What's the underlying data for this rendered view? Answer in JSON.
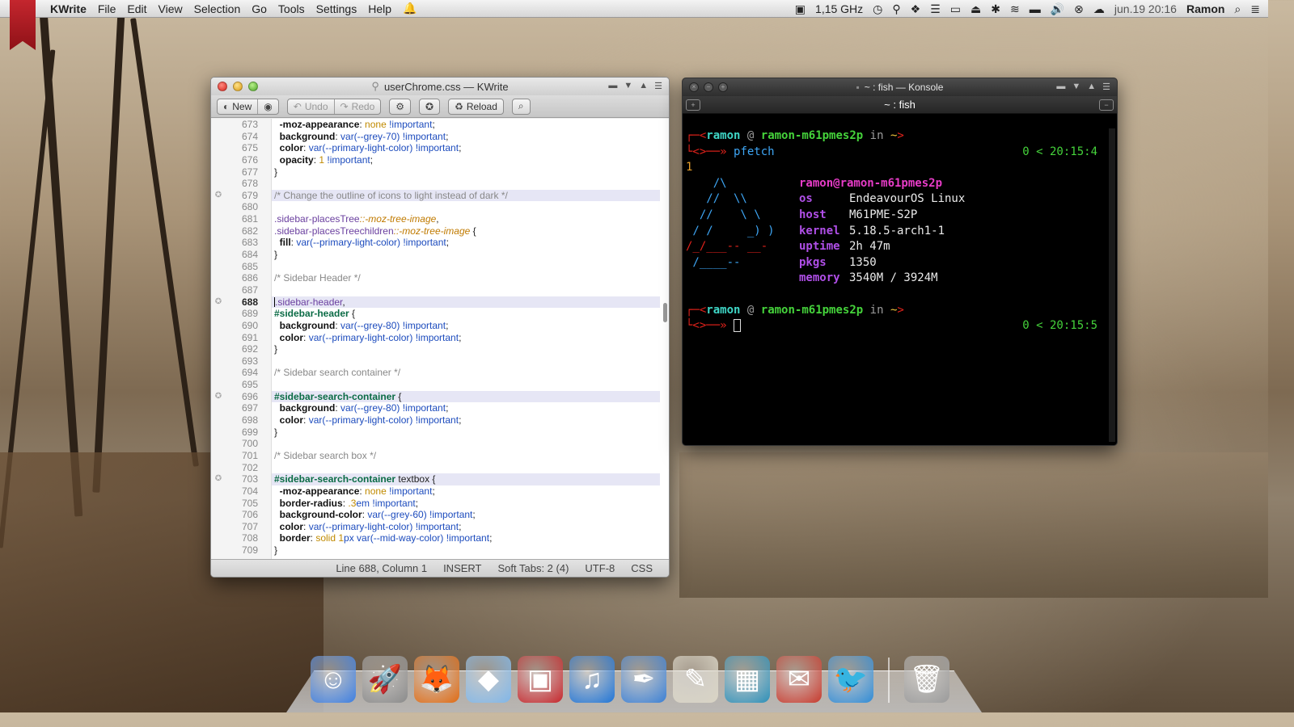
{
  "menubar": {
    "app_name": "KWrite",
    "menus": [
      "File",
      "Edit",
      "View",
      "Selection",
      "Go",
      "Tools",
      "Settings",
      "Help"
    ],
    "cpu_freq": "1,15 GHz",
    "datetime": "jun.19 20:16",
    "user": "Ramon"
  },
  "kwrite": {
    "title": "userChrome.css — KWrite",
    "toolbar": {
      "new": "New",
      "undo": "Undo",
      "redo": "Redo",
      "reload": "Reload"
    },
    "lines": [
      {
        "num": "673",
        "mark": false,
        "hl": false,
        "parts": [
          [
            "prop",
            "  -moz-appearance"
          ],
          [
            "plain",
            ": "
          ],
          [
            "kw",
            "none"
          ],
          [
            "imp",
            " !important"
          ],
          [
            "plain",
            ";"
          ]
        ]
      },
      {
        "num": "674",
        "mark": false,
        "hl": false,
        "parts": [
          [
            "prop",
            "  background"
          ],
          [
            "plain",
            ": "
          ],
          [
            "val",
            "var(--grey-70)"
          ],
          [
            "imp",
            " !important"
          ],
          [
            "plain",
            ";"
          ]
        ]
      },
      {
        "num": "675",
        "mark": false,
        "hl": false,
        "parts": [
          [
            "prop",
            "  color"
          ],
          [
            "plain",
            ": "
          ],
          [
            "val",
            "var(--primary-light-color)"
          ],
          [
            "imp",
            " !important"
          ],
          [
            "plain",
            ";"
          ]
        ]
      },
      {
        "num": "676",
        "mark": false,
        "hl": false,
        "parts": [
          [
            "prop",
            "  opacity"
          ],
          [
            "plain",
            ": "
          ],
          [
            "kw",
            "1"
          ],
          [
            "imp",
            " !important"
          ],
          [
            "plain",
            ";"
          ]
        ]
      },
      {
        "num": "677",
        "mark": false,
        "hl": false,
        "parts": [
          [
            "plain",
            "}"
          ]
        ]
      },
      {
        "num": "678",
        "mark": false,
        "hl": false,
        "parts": []
      },
      {
        "num": "679",
        "mark": true,
        "hl": true,
        "parts": [
          [
            "cmt",
            "/* Change the outline of icons to light instead of dark */"
          ]
        ]
      },
      {
        "num": "680",
        "mark": false,
        "hl": false,
        "parts": []
      },
      {
        "num": "681",
        "mark": false,
        "hl": false,
        "parts": [
          [
            "sel",
            ".sidebar-placesTree"
          ],
          [
            "pseudo",
            "::-moz-tree-image"
          ],
          [
            "plain",
            ","
          ]
        ]
      },
      {
        "num": "682",
        "mark": false,
        "hl": false,
        "parts": [
          [
            "sel",
            ".sidebar-placesTreechildren"
          ],
          [
            "pseudo",
            "::-moz-tree-image"
          ],
          [
            "plain",
            " {"
          ]
        ]
      },
      {
        "num": "683",
        "mark": false,
        "hl": false,
        "parts": [
          [
            "prop",
            "  fill"
          ],
          [
            "plain",
            ": "
          ],
          [
            "val",
            "var(--primary-light-color)"
          ],
          [
            "imp",
            " !important"
          ],
          [
            "plain",
            ";"
          ]
        ]
      },
      {
        "num": "684",
        "mark": false,
        "hl": false,
        "parts": [
          [
            "plain",
            "}"
          ]
        ]
      },
      {
        "num": "685",
        "mark": false,
        "hl": false,
        "parts": []
      },
      {
        "num": "686",
        "mark": false,
        "hl": false,
        "parts": [
          [
            "cmt",
            "/* Sidebar Header */"
          ]
        ]
      },
      {
        "num": "687",
        "mark": false,
        "hl": false,
        "parts": []
      },
      {
        "num": "688",
        "mark": true,
        "hl": true,
        "current": true,
        "parts": [
          [
            "sel",
            ".sidebar-header"
          ],
          [
            "plain",
            ","
          ]
        ]
      },
      {
        "num": "689",
        "mark": false,
        "hl": false,
        "parts": [
          [
            "idsel",
            "#sidebar-header"
          ],
          [
            "plain",
            " {"
          ]
        ]
      },
      {
        "num": "690",
        "mark": false,
        "hl": false,
        "parts": [
          [
            "prop",
            "  background"
          ],
          [
            "plain",
            ": "
          ],
          [
            "val",
            "var(--grey-80)"
          ],
          [
            "imp",
            " !important"
          ],
          [
            "plain",
            ";"
          ]
        ]
      },
      {
        "num": "691",
        "mark": false,
        "hl": false,
        "parts": [
          [
            "prop",
            "  color"
          ],
          [
            "plain",
            ": "
          ],
          [
            "val",
            "var(--primary-light-color)"
          ],
          [
            "imp",
            " !important"
          ],
          [
            "plain",
            ";"
          ]
        ]
      },
      {
        "num": "692",
        "mark": false,
        "hl": false,
        "parts": [
          [
            "plain",
            "}"
          ]
        ]
      },
      {
        "num": "693",
        "mark": false,
        "hl": false,
        "parts": []
      },
      {
        "num": "694",
        "mark": false,
        "hl": false,
        "parts": [
          [
            "cmt",
            "/* Sidebar search container */"
          ]
        ]
      },
      {
        "num": "695",
        "mark": false,
        "hl": false,
        "parts": []
      },
      {
        "num": "696",
        "mark": true,
        "hl": true,
        "parts": [
          [
            "idsel",
            "#sidebar-search-container"
          ],
          [
            "plain",
            " {"
          ]
        ]
      },
      {
        "num": "697",
        "mark": false,
        "hl": false,
        "parts": [
          [
            "prop",
            "  background"
          ],
          [
            "plain",
            ": "
          ],
          [
            "val",
            "var(--grey-80)"
          ],
          [
            "imp",
            " !important"
          ],
          [
            "plain",
            ";"
          ]
        ]
      },
      {
        "num": "698",
        "mark": false,
        "hl": false,
        "parts": [
          [
            "prop",
            "  color"
          ],
          [
            "plain",
            ": "
          ],
          [
            "val",
            "var(--primary-light-color)"
          ],
          [
            "imp",
            " !important"
          ],
          [
            "plain",
            ";"
          ]
        ]
      },
      {
        "num": "699",
        "mark": false,
        "hl": false,
        "parts": [
          [
            "plain",
            "}"
          ]
        ]
      },
      {
        "num": "700",
        "mark": false,
        "hl": false,
        "parts": []
      },
      {
        "num": "701",
        "mark": false,
        "hl": false,
        "parts": [
          [
            "cmt",
            "/* Sidebar search box */"
          ]
        ]
      },
      {
        "num": "702",
        "mark": false,
        "hl": false,
        "parts": []
      },
      {
        "num": "703",
        "mark": true,
        "hl": true,
        "parts": [
          [
            "idsel",
            "#sidebar-search-container"
          ],
          [
            "plain",
            " textbox {"
          ]
        ]
      },
      {
        "num": "704",
        "mark": false,
        "hl": false,
        "parts": [
          [
            "prop",
            "  -moz-appearance"
          ],
          [
            "plain",
            ": "
          ],
          [
            "kw",
            "none"
          ],
          [
            "imp",
            " !important"
          ],
          [
            "plain",
            ";"
          ]
        ]
      },
      {
        "num": "705",
        "mark": false,
        "hl": false,
        "parts": [
          [
            "prop",
            "  border-radius"
          ],
          [
            "plain",
            ": "
          ],
          [
            "kw",
            ".3"
          ],
          [
            "val",
            "em"
          ],
          [
            "imp",
            " !important"
          ],
          [
            "plain",
            ";"
          ]
        ]
      },
      {
        "num": "706",
        "mark": false,
        "hl": false,
        "parts": [
          [
            "prop",
            "  background-color"
          ],
          [
            "plain",
            ": "
          ],
          [
            "val",
            "var(--grey-60)"
          ],
          [
            "imp",
            " !important"
          ],
          [
            "plain",
            ";"
          ]
        ]
      },
      {
        "num": "707",
        "mark": false,
        "hl": false,
        "parts": [
          [
            "prop",
            "  color"
          ],
          [
            "plain",
            ": "
          ],
          [
            "val",
            "var(--primary-light-color)"
          ],
          [
            "imp",
            " !important"
          ],
          [
            "plain",
            ";"
          ]
        ]
      },
      {
        "num": "708",
        "mark": false,
        "hl": false,
        "parts": [
          [
            "prop",
            "  border"
          ],
          [
            "plain",
            ": "
          ],
          [
            "kw",
            "solid 1"
          ],
          [
            "val",
            "px var(--mid-way-color)"
          ],
          [
            "imp",
            " !important"
          ],
          [
            "plain",
            ";"
          ]
        ]
      },
      {
        "num": "709",
        "mark": false,
        "hl": false,
        "parts": [
          [
            "plain",
            "}"
          ]
        ]
      }
    ],
    "status": {
      "position": "Line 688, Column 1",
      "mode": "INSERT",
      "tabs": "Soft Tabs: 2 (4)",
      "encoding": "UTF-8",
      "syntax": "CSS"
    }
  },
  "konsole": {
    "title": "~ : fish — Konsole",
    "tab_label": "~ : fish",
    "prompt1": {
      "user": "ramon",
      "at": "@",
      "host": "ramon-m61pmes2p",
      "in": "in",
      "dir": "~",
      "command": "pfetch",
      "status": "0 < 20:15:4",
      "wrap": "1"
    },
    "pfetch": {
      "header": "ramon@ramon-m61pmes2p",
      "art": [
        "    /\\",
        "   //  \\\\",
        "  //    \\ \\",
        " / /     _) )",
        "/_/___-- __-",
        " /____--"
      ],
      "rows": [
        {
          "key": "os",
          "value": "EndeavourOS Linux"
        },
        {
          "key": "host",
          "value": "M61PME-S2P"
        },
        {
          "key": "kernel",
          "value": "5.18.5-arch1-1"
        },
        {
          "key": "uptime",
          "value": "2h 47m"
        },
        {
          "key": "pkgs",
          "value": "1350"
        },
        {
          "key": "memory",
          "value": "3540M / 3924M"
        }
      ]
    },
    "prompt2": {
      "user": "ramon",
      "at": "@",
      "host": "ramon-m61pmes2p",
      "in": "in",
      "dir": "~",
      "status": "0 < 20:15:5"
    }
  },
  "dock": {
    "items": [
      {
        "name": "finder-icon",
        "glyph": "☺",
        "color": "#3d7ee0"
      },
      {
        "name": "launchpad-icon",
        "glyph": "🚀",
        "color": "#8a8a8a"
      },
      {
        "name": "firefox-icon",
        "glyph": "🦊",
        "color": "#e06a12"
      },
      {
        "name": "sketch-gem-icon",
        "glyph": "◆",
        "color": "#7fb6e8"
      },
      {
        "name": "box-app-icon",
        "glyph": "▣",
        "color": "#c6262b"
      },
      {
        "name": "itunes-icon",
        "glyph": "♫",
        "color": "#1f74d6"
      },
      {
        "name": "quill-icon",
        "glyph": "✒",
        "color": "#3a7fd4"
      },
      {
        "name": "textedit-icon",
        "glyph": "✎",
        "color": "#d9d4c4"
      },
      {
        "name": "photos-icon",
        "glyph": "▦",
        "color": "#2c8fb8"
      },
      {
        "name": "mail-icon",
        "glyph": "✉",
        "color": "#c7392c"
      },
      {
        "name": "twitter-bird-icon",
        "glyph": "🐦",
        "color": "#2f8bd6"
      }
    ],
    "trash": {
      "name": "trash-icon",
      "glyph": "🗑",
      "color": "#9a9a9a"
    }
  }
}
